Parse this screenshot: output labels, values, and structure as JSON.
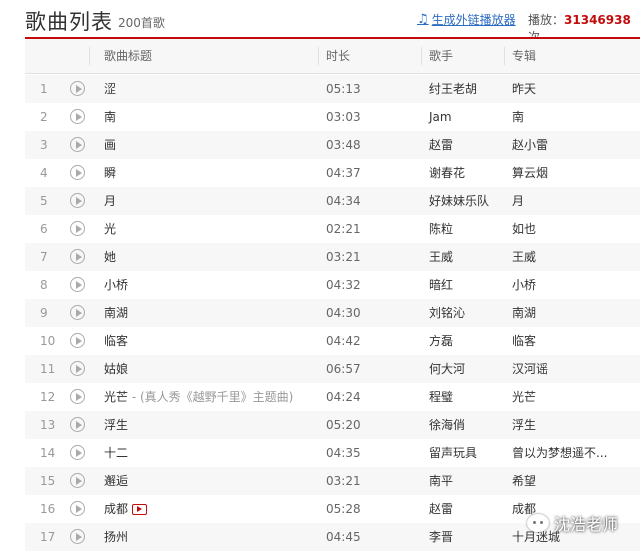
{
  "header": {
    "title": "歌曲列表",
    "count": "200首歌",
    "generate_link": "生成外链播放器",
    "plays_label": "播放：",
    "plays_value": "31346938",
    "plays_suffix": "次"
  },
  "table": {
    "columns": [
      "歌曲标题",
      "时长",
      "歌手",
      "专辑"
    ],
    "rows": [
      {
        "idx": "1",
        "name": "涩",
        "sub": "",
        "mv": false,
        "time": "05:13",
        "artist": "纣王老胡",
        "album": "昨天"
      },
      {
        "idx": "2",
        "name": "南",
        "sub": "",
        "mv": false,
        "time": "03:03",
        "artist": "Jam",
        "album": "南"
      },
      {
        "idx": "3",
        "name": "画",
        "sub": "",
        "mv": false,
        "time": "03:48",
        "artist": "赵雷",
        "album": "赵小雷"
      },
      {
        "idx": "4",
        "name": "瞬",
        "sub": "",
        "mv": false,
        "time": "04:37",
        "artist": "谢春花",
        "album": "算云烟"
      },
      {
        "idx": "5",
        "name": "月",
        "sub": "",
        "mv": false,
        "time": "04:34",
        "artist": "好妹妹乐队",
        "album": "月"
      },
      {
        "idx": "6",
        "name": "光",
        "sub": "",
        "mv": false,
        "time": "02:21",
        "artist": "陈粒",
        "album": "如也"
      },
      {
        "idx": "7",
        "name": "她",
        "sub": "",
        "mv": false,
        "time": "03:21",
        "artist": "王威",
        "album": "王威"
      },
      {
        "idx": "8",
        "name": "小桥",
        "sub": "",
        "mv": false,
        "time": "04:32",
        "artist": "暗红",
        "album": "小桥"
      },
      {
        "idx": "9",
        "name": "南湖",
        "sub": "",
        "mv": false,
        "time": "04:30",
        "artist": "刘铭沁",
        "album": "南湖"
      },
      {
        "idx": "10",
        "name": "临客",
        "sub": "",
        "mv": false,
        "time": "04:42",
        "artist": "方磊",
        "album": "临客"
      },
      {
        "idx": "11",
        "name": "姑娘",
        "sub": "",
        "mv": false,
        "time": "06:57",
        "artist": "何大河",
        "album": "汉河谣"
      },
      {
        "idx": "12",
        "name": "光芒",
        "sub": " - (真人秀《越野千里》主题曲)",
        "mv": false,
        "time": "04:24",
        "artist": "程璧",
        "album": "光芒"
      },
      {
        "idx": "13",
        "name": "浮生",
        "sub": "",
        "mv": false,
        "time": "05:20",
        "artist": "徐海俏",
        "album": "浮生"
      },
      {
        "idx": "14",
        "name": "十二",
        "sub": "",
        "mv": false,
        "time": "04:35",
        "artist": "留声玩具",
        "album": "曾以为梦想遥不..."
      },
      {
        "idx": "15",
        "name": "邂逅",
        "sub": "",
        "mv": false,
        "time": "03:21",
        "artist": "南平",
        "album": "希望"
      },
      {
        "idx": "16",
        "name": "成都",
        "sub": "",
        "mv": true,
        "time": "05:28",
        "artist": "赵雷",
        "album": "成都"
      },
      {
        "idx": "17",
        "name": "扬州",
        "sub": "",
        "mv": false,
        "time": "04:45",
        "artist": "李晋",
        "album": "十月迷城"
      }
    ]
  },
  "watermark": "沈浩老师",
  "colors": {
    "accent": "#c20c0c",
    "link": "#2b6cc2",
    "stripe": "#f7f7f7"
  }
}
